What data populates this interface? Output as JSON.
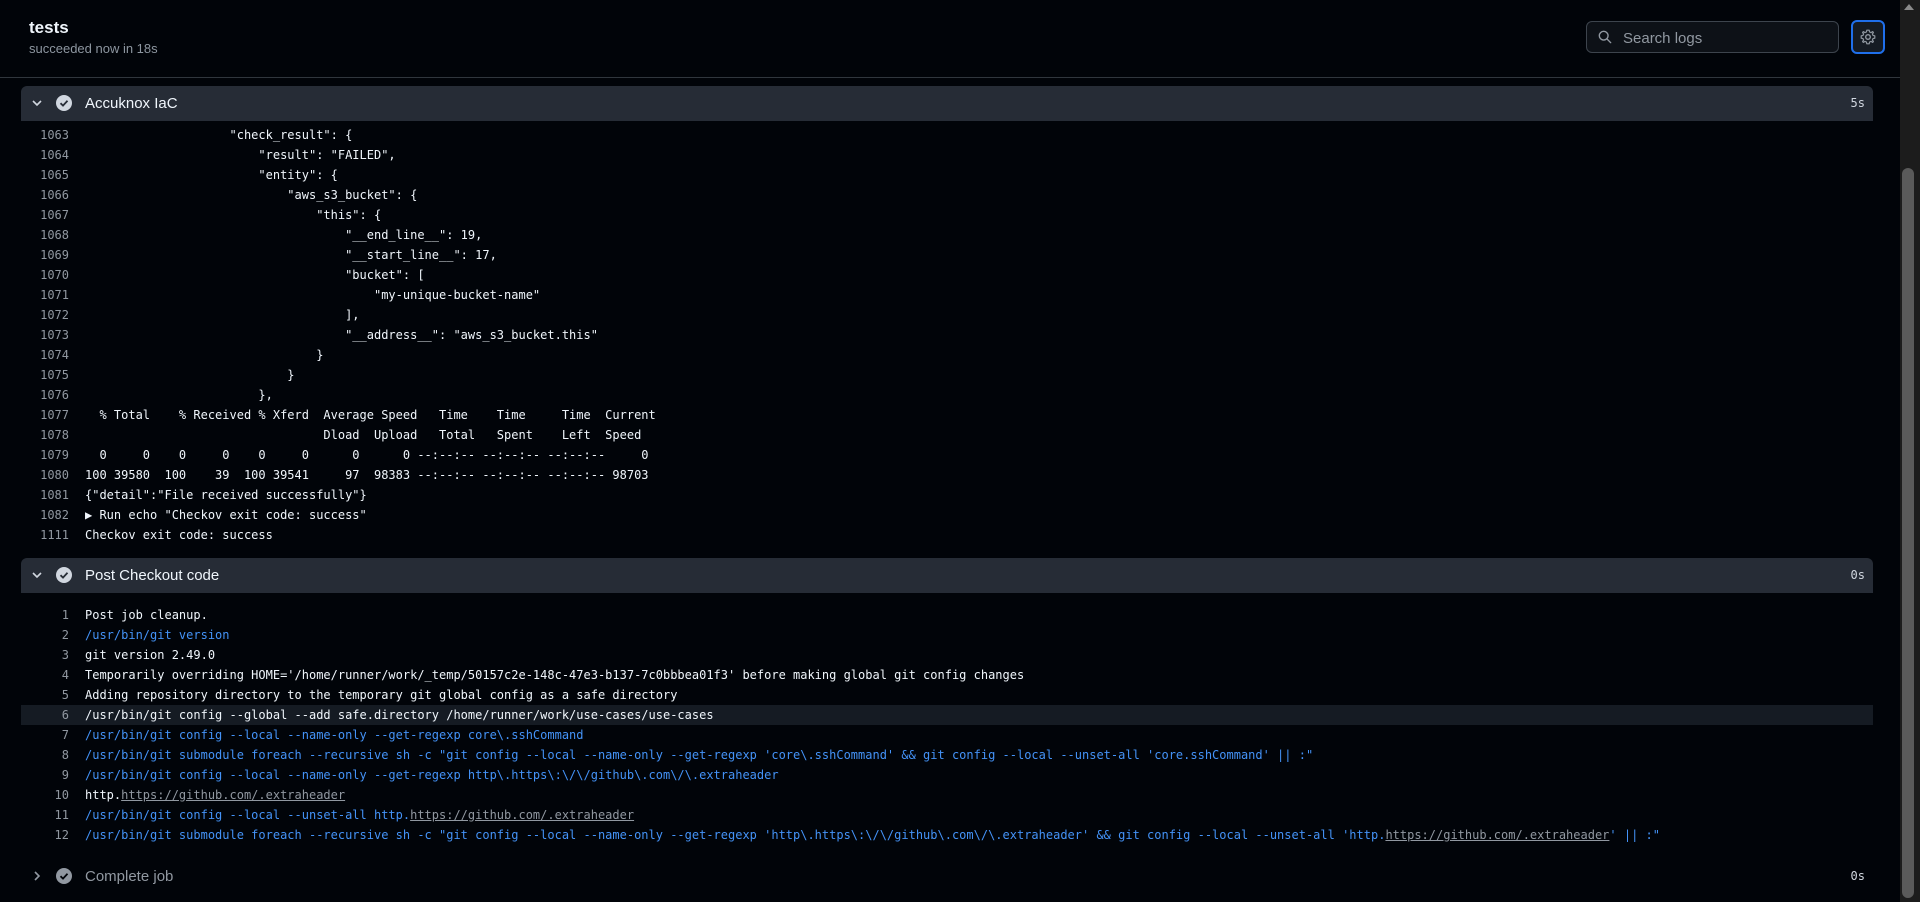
{
  "header": {
    "title": "tests",
    "status": "succeeded now in 18s",
    "search_placeholder": "Search logs",
    "settings_icon": "gear-icon"
  },
  "steps": [
    {
      "name": "Accuknox IaC",
      "duration": "5s",
      "expanded": true,
      "lines": [
        {
          "n": "1063",
          "t": "                    \"check_result\": {"
        },
        {
          "n": "1064",
          "t": "                        \"result\": \"FAILED\","
        },
        {
          "n": "1065",
          "t": "                        \"entity\": {"
        },
        {
          "n": "1066",
          "t": "                            \"aws_s3_bucket\": {"
        },
        {
          "n": "1067",
          "t": "                                \"this\": {"
        },
        {
          "n": "1068",
          "t": "                                    \"__end_line__\": 19,"
        },
        {
          "n": "1069",
          "t": "                                    \"__start_line__\": 17,"
        },
        {
          "n": "1070",
          "t": "                                    \"bucket\": ["
        },
        {
          "n": "1071",
          "t": "                                        \"my-unique-bucket-name\""
        },
        {
          "n": "1072",
          "t": "                                    ],"
        },
        {
          "n": "1073",
          "t": "                                    \"__address__\": \"aws_s3_bucket.this\""
        },
        {
          "n": "1074",
          "t": "                                }"
        },
        {
          "n": "1075",
          "t": "                            }"
        },
        {
          "n": "1076",
          "t": "                        },"
        },
        {
          "n": "1077",
          "t": "  % Total    % Received % Xferd  Average Speed   Time    Time     Time  Current"
        },
        {
          "n": "1078",
          "t": "                                 Dload  Upload   Total   Spent    Left  Speed"
        },
        {
          "n": "1079",
          "t": "  0     0    0     0    0     0      0      0 --:--:-- --:--:-- --:--:--     0"
        },
        {
          "n": "1080",
          "t": "100 39580  100    39  100 39541     97  98383 --:--:-- --:--:-- --:--:-- 98703"
        },
        {
          "n": "1081",
          "t": "{\"detail\":\"File received successfully\"}"
        },
        {
          "n": "1082",
          "t": "▶ Run echo \"Checkov exit code: success\""
        },
        {
          "n": "1111",
          "t": "Checkov exit code: success"
        }
      ]
    },
    {
      "name": "Post Checkout code",
      "duration": "0s",
      "expanded": true,
      "lines": [
        {
          "n": "1",
          "t": "Post job cleanup."
        },
        {
          "n": "2",
          "t": "/usr/bin/git version"
        },
        {
          "n": "3",
          "t": "git version 2.49.0"
        },
        {
          "n": "4",
          "t": "Temporarily overriding HOME='/home/runner/work/_temp/50157c2e-148c-47e3-b137-7c0bbbea01f3' before making global git config changes"
        },
        {
          "n": "5",
          "t": "Adding repository directory to the temporary git global config as a safe directory"
        },
        {
          "n": "6",
          "t": "/usr/bin/git config --global --add safe.directory /home/runner/work/use-cases/use-cases"
        },
        {
          "n": "7",
          "t": "/usr/bin/git config --local --name-only --get-regexp core\\.sshCommand"
        },
        {
          "n": "8",
          "t": "/usr/bin/git submodule foreach --recursive sh -c \"git config --local --name-only --get-regexp 'core\\.sshCommand' && git config --local --unset-all 'core.sshCommand' || :\""
        },
        {
          "n": "9",
          "t": "/usr/bin/git config --local --name-only --get-regexp http\\.https\\:\\/\\/github\\.com\\/\\.extraheader"
        },
        {
          "n": "10",
          "t_pre": "http.",
          "t_link": "https://github.com/.extraheader",
          "t_post": ""
        },
        {
          "n": "11",
          "t_pre": "/usr/bin/git config --local --unset-all http.",
          "t_link": "https://github.com/.extraheader",
          "t_post": ""
        },
        {
          "n": "12",
          "t_pre": "/usr/bin/git submodule foreach --recursive sh -c \"git config --local --name-only --get-regexp 'http\\.https\\:\\/\\/github\\.com\\/\\.extraheader' && git config --local --unset-all 'http.",
          "t_link": "https://github.com/.extraheader",
          "t_post": "' || :\""
        }
      ]
    },
    {
      "name": "Complete job",
      "duration": "0s",
      "expanded": false,
      "lines": []
    }
  ],
  "colors": {
    "command_blue": "#4493f8",
    "success_check": "#d1d7e0"
  }
}
